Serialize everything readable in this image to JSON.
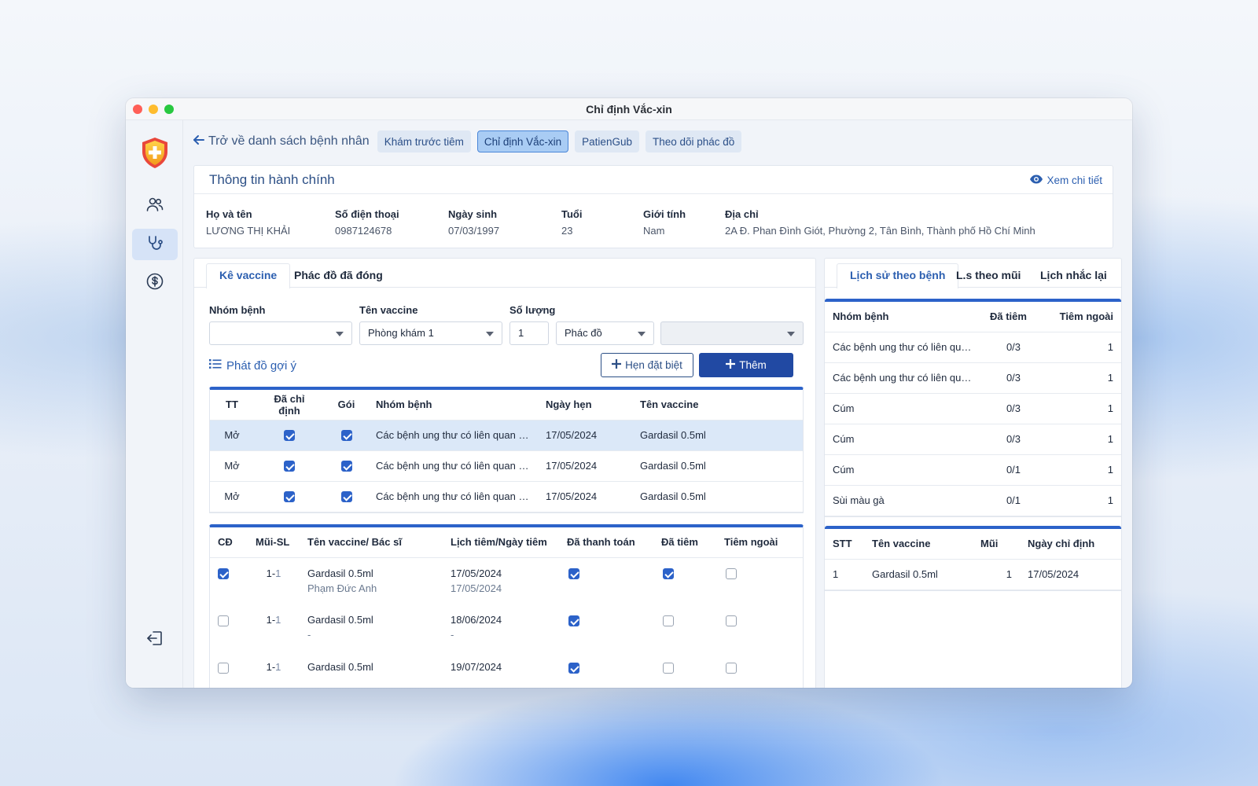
{
  "window": {
    "title": "Chỉ định Vắc-xin"
  },
  "topnav": {
    "back_label": "Trở về danh sách bệnh nhân",
    "tabs": [
      {
        "label": "Khám trước tiêm",
        "active": false
      },
      {
        "label": "Chỉ định Vắc-xin",
        "active": true
      },
      {
        "label": "PatienGub",
        "active": false
      },
      {
        "label": "Theo dõi phác đồ",
        "active": false
      }
    ]
  },
  "admin": {
    "title": "Thông tin hành chính",
    "detail_link": "Xem chi tiết",
    "fields": [
      {
        "label": "Họ và tên",
        "value": "LƯƠNG THỊ KHẢI"
      },
      {
        "label": "Số điện thoại",
        "value": "0987124678"
      },
      {
        "label": "Ngày sinh",
        "value": "07/03/1997"
      },
      {
        "label": "Tuổi",
        "value": "23"
      },
      {
        "label": "Giới tính",
        "value": "Nam"
      },
      {
        "label": "Địa chỉ",
        "value": "2A Đ. Phan Đình Giót, Phường 2, Tân Bình, Thành phố Hồ Chí Minh"
      }
    ]
  },
  "left_panel": {
    "tabs": [
      "Kê vaccine",
      "Phác đồ đã đóng"
    ],
    "form": {
      "group_label": "Nhóm bệnh",
      "group_value": "",
      "vaccine_label": "Tên vaccine",
      "vaccine_value": "Phòng khám 1",
      "qty_label": "Số lượng",
      "qty_value": "1",
      "regimen_value": "Phác đồ",
      "extra_value": ""
    },
    "suggest_label": "Phát đồ gợi ý",
    "btn_appointment": "Hẹn đặt biệt",
    "btn_add": "Thêm",
    "table1": {
      "headers": [
        "TT",
        "Đã chỉ định",
        "Gói",
        "Nhóm bệnh",
        "Ngày hẹn",
        "Tên vaccine"
      ],
      "rows": [
        {
          "tt": "Mở",
          "assigned": true,
          "package": true,
          "group": "Các bệnh ung thư có liên quan đến HPV",
          "date": "17/05/2024",
          "vaccine": "Gardasil 0.5ml"
        },
        {
          "tt": "Mở",
          "assigned": true,
          "package": true,
          "group": "Các bệnh ung thư có liên quan đến HPV",
          "date": "17/05/2024",
          "vaccine": "Gardasil 0.5ml"
        },
        {
          "tt": "Mở",
          "assigned": true,
          "package": true,
          "group": "Các bệnh ung thư có liên quan đến HPV",
          "date": "17/05/2024",
          "vaccine": "Gardasil 0.5ml"
        }
      ]
    },
    "table2": {
      "headers": [
        "CĐ",
        "Mũi-SL",
        "Tên vaccine/ Bác sĩ",
        "Lịch tiêm/Ngày tiêm",
        "Đã thanh toán",
        "Đã tiêm",
        "Tiêm ngoài"
      ],
      "rows": [
        {
          "cd": true,
          "dose_a": "1-",
          "dose_b": "1",
          "vaccine": "Gardasil 0.5ml",
          "doctor": "Phạm Đức Anh",
          "schedule": "17/05/2024",
          "injected_date": "17/05/2024",
          "paid": true,
          "injected": true,
          "external": false
        },
        {
          "cd": false,
          "dose_a": "1-",
          "dose_b": "1",
          "vaccine": "Gardasil 0.5ml",
          "doctor": "-",
          "schedule": "18/06/2024",
          "injected_date": "-",
          "paid": true,
          "injected": false,
          "external": false
        },
        {
          "cd": false,
          "dose_a": "1-",
          "dose_b": "1",
          "vaccine": "Gardasil 0.5ml",
          "doctor": "",
          "schedule": "19/07/2024",
          "injected_date": "",
          "paid": true,
          "injected": false,
          "external": false
        }
      ]
    }
  },
  "right_panel": {
    "tabs": [
      "Lịch sử theo bệnh",
      "L.s theo mũi",
      "Lịch nhắc lại"
    ],
    "history": {
      "headers": [
        "Nhóm bệnh",
        "Đã tiêm",
        "Tiêm ngoài"
      ],
      "rows": [
        {
          "group": "Các bệnh ung thư có liên quan đến HPV",
          "done": "0/3",
          "external": "1"
        },
        {
          "group": "Các bệnh ung thư có liên quan đến HPV",
          "done": "0/3",
          "external": "1"
        },
        {
          "group": "Cúm",
          "done": "0/3",
          "external": "1"
        },
        {
          "group": "Cúm",
          "done": "0/3",
          "external": "1"
        },
        {
          "group": "Cúm",
          "done": "0/1",
          "external": "1"
        },
        {
          "group": "Sùi màu gà",
          "done": "0/1",
          "external": "1"
        }
      ]
    },
    "detail": {
      "headers": [
        "STT",
        "Tên vaccine",
        "Mũi",
        "Ngày chỉ định"
      ],
      "rows": [
        {
          "stt": "1",
          "vaccine": "Gardasil 0.5ml",
          "dose": "1",
          "date": "17/05/2024"
        }
      ]
    }
  },
  "colors": {
    "accent": "#2c62c9",
    "primary_button": "#2149a3",
    "title": "#2c4f86",
    "selected_row": "#dbe8f8"
  },
  "icons": [
    "logo-shield-icon",
    "users-icon",
    "stethoscope-icon",
    "dollar-icon",
    "logout-icon",
    "arrow-left-icon",
    "eye-icon",
    "list-icon",
    "plus-icon",
    "chevron-down-icon"
  ]
}
